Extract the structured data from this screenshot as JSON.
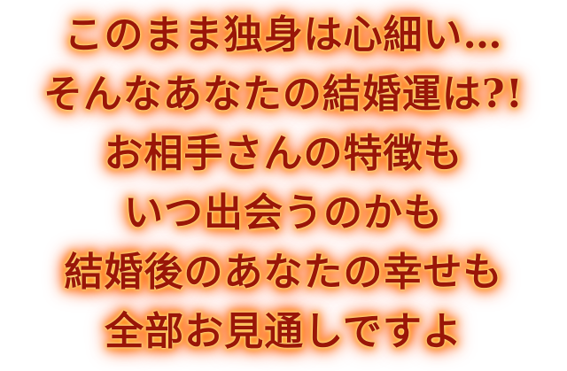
{
  "banner": {
    "lines": [
      "このまま独身は心細い…",
      "そんなあなたの結婚運は?!",
      "お相手さんの特徴も",
      "いつ出会うのかも",
      "結婚後のあなたの幸せも",
      "全部お見通しですよ"
    ]
  }
}
